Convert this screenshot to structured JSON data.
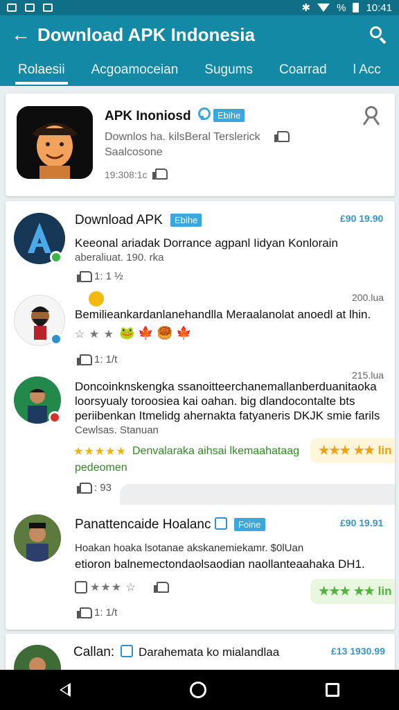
{
  "status": {
    "time": "10:41",
    "battery_text": "%"
  },
  "appbar": {
    "title": "Download APK Indonesia"
  },
  "tabs": [
    {
      "label": "Rolaesii"
    },
    {
      "label": "Acgoamoceian"
    },
    {
      "label": "Sugums"
    },
    {
      "label": "Coarrad"
    },
    {
      "label": "l Acc"
    }
  ],
  "featured": {
    "title": "APK Inoniosd",
    "badge": "Ebihe",
    "line1": "Downlos ha. kilsBeral Terslerick",
    "line2": "Saalcosone",
    "meta": "19:308:1c"
  },
  "posts": [
    {
      "title": "Download APK",
      "badge": "Ebihe",
      "price": "£90 19.90",
      "text": [
        "Keeonal ariadak Dorrance agpanl Iidyan Konlorain",
        "aberaliuat. 190. rka"
      ],
      "meta": "1: 1 ½"
    },
    {
      "timestamp": "200.lua",
      "text": [
        "Bemilieankardanlanehandlla Meraalanolat anoedl at lhin."
      ],
      "emojis": "🐸 🍁 🥮 🍁",
      "meta": "1: 1/t"
    },
    {
      "timestamp": "215.lua",
      "text": [
        "Doncoinknskengka ssanoitteerchanemallanberduanitaoka",
        "loorsyualy toroosiea kai oahan. big dlandocontalte bts",
        "periibenkan Itmelidg ahernakta fatyaneris DKJK smie farils",
        "Cewlsas. Stanuan"
      ],
      "green_text": "Denvalaraka aihsai lkemaahataag",
      "green_text2": "pedeomen",
      "chip": "lin",
      "meta": ": 93"
    },
    {
      "title": "Panattencaide Hoalanc",
      "badge": "Foine",
      "price": "£90 19.91",
      "text": [
        "Hoakan hoaka lsotanae akskanemiekamr.  $0lUan",
        "etioron balnemectondaolsaodian naollanteaahaka DH1."
      ],
      "chip": "lin",
      "meta": "1: 1/t"
    },
    {
      "title": "Callan:",
      "title2": "Darahemata ko mialandlaa",
      "price": "£13 1930.99"
    }
  ],
  "colors": {
    "appbar": "#1489a6",
    "statusbar": "#0e6f86",
    "accent": "#3ba7dc",
    "price": "#3695c8"
  }
}
